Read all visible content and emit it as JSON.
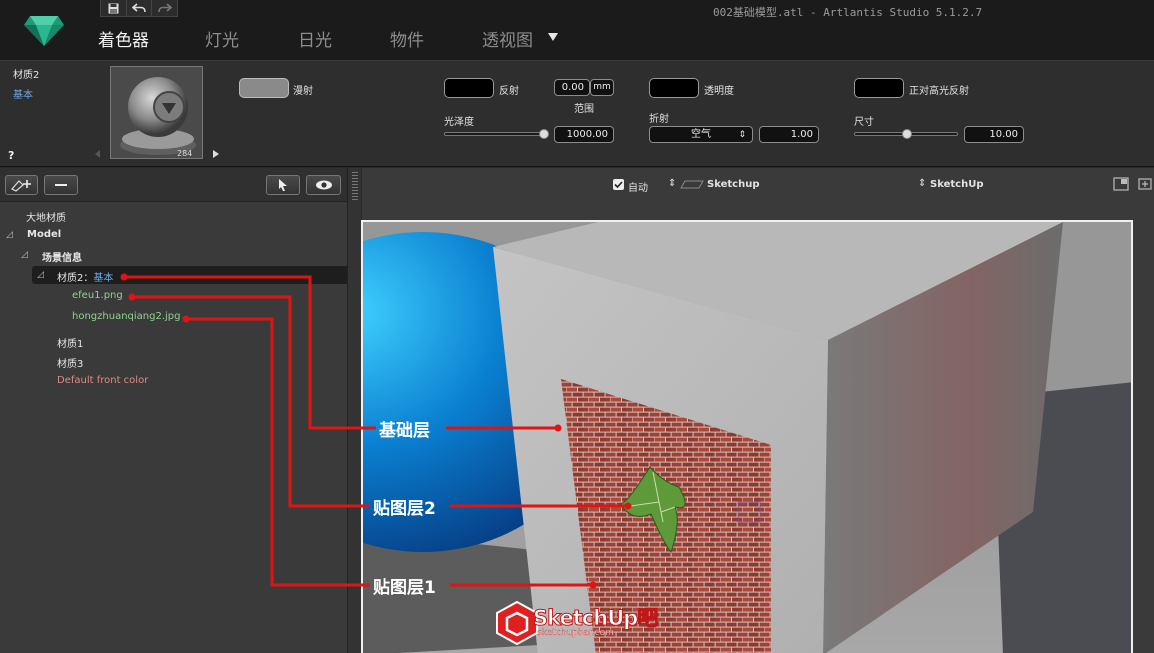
{
  "window": {
    "title": "002基础模型.atl - Artlantis Studio 5.1.2.7"
  },
  "tabs": [
    {
      "label": "着色器",
      "active": true
    },
    {
      "label": "灯光",
      "active": false
    },
    {
      "label": "日光",
      "active": false
    },
    {
      "label": "物件",
      "active": false
    },
    {
      "label": "透视图",
      "active": false
    }
  ],
  "material": {
    "name": "材质2",
    "type": "基本",
    "help": "?",
    "thumb_label": "284",
    "diffuse_label": "漫射",
    "reflection_label": "反射",
    "range_value": "0.00",
    "range_unit": "mm",
    "range_label": "范围",
    "gloss_label": "光泽度",
    "gloss_value": "1000.00",
    "gloss_level": 1.0,
    "transparency_label": "透明度",
    "refraction_label": "折射",
    "refraction_option": "空气",
    "refraction_value": "1.00",
    "specular_label": "正对高光反射",
    "size_label": "尺寸",
    "size_value": "10.00",
    "size_level": 0.5
  },
  "tree": {
    "global": "大地材质",
    "model": "Model",
    "scene": "场景信息",
    "selected_prefix": "材质2：",
    "selected_type": "基本",
    "layer_efeu": "efeu1.png",
    "layer_brick": "hongzhuanqiang2.jpg",
    "mat1": "材质1",
    "mat3": "材质3",
    "front": "Default front color"
  },
  "viewtool": {
    "auto_label": "自动",
    "auto_checked": true,
    "source_left": "Sketchup",
    "source_right": "SketchUp"
  },
  "annotations": {
    "base_layer": "基础层",
    "map_layer_2": "贴图层2",
    "map_layer_1": "贴图层1"
  },
  "watermark": {
    "brand": "SketchUp吧",
    "url": "sketchupbar.com"
  },
  "colors": {
    "annotation_red": "#e11414",
    "selected_blue": "#6fa8e8",
    "layer_green": "#8ed28e",
    "front_pink": "#e08a8a"
  }
}
